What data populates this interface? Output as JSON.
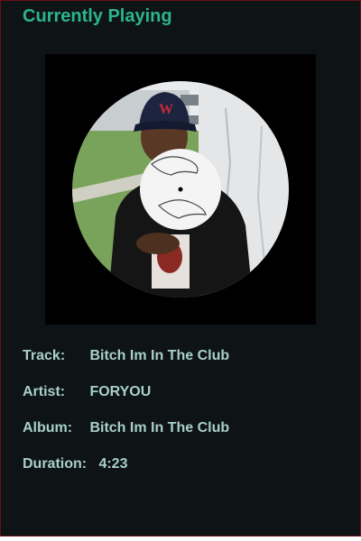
{
  "header": {
    "title": "Currently Playing"
  },
  "cover": {
    "alt": "album cover vinyl"
  },
  "track": {
    "label": "Track:",
    "value": "Bitch Im In The Club"
  },
  "artist": {
    "label": "Artist:",
    "value": "FORYOU"
  },
  "album": {
    "label": "Album:",
    "value": "Bitch Im In The Club"
  },
  "duration": {
    "label": "Duration:",
    "value": "4:23"
  },
  "colors": {
    "background": "#0e1316",
    "title": "#2bb58c",
    "text": "#a8cfcc",
    "border": "#6b1016"
  }
}
